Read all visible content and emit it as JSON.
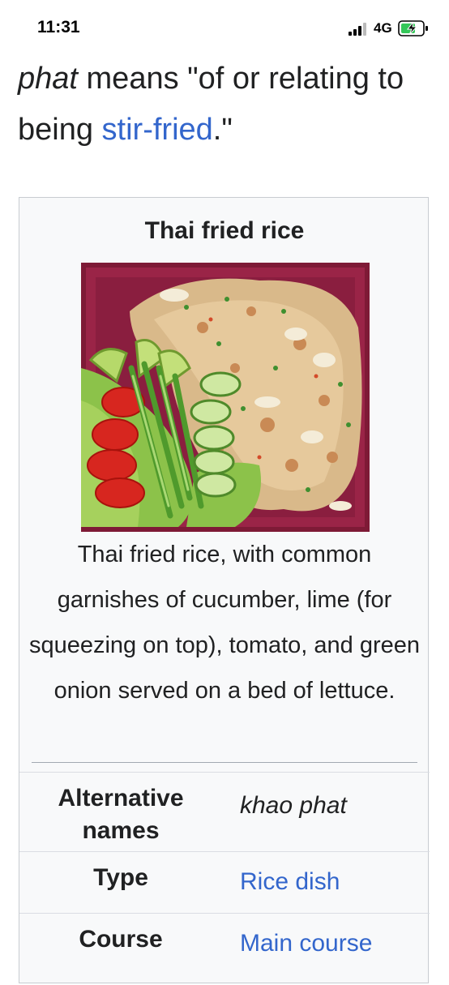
{
  "status": {
    "time": "11:31",
    "network": "4G"
  },
  "intro": {
    "italic_word": "phat",
    "text_before_link": " means \"of or relating to being ",
    "link_text": "stir-fried",
    "text_after_link": ".\""
  },
  "infobox": {
    "title": "Thai fried rice",
    "caption": "Thai fried rice, with common garnishes of cucumber, lime (for squeezing on top), tomato, and green onion served on a bed of lettuce.",
    "rows": [
      {
        "label": "Alternative names",
        "value": "khao phat"
      },
      {
        "label": "Type",
        "value": "Rice dish"
      },
      {
        "label": "Course",
        "value": "Main course"
      }
    ]
  },
  "colors": {
    "link": "#3366cc",
    "text": "#202122",
    "infobox_bg": "#f8f9fa",
    "plate": "#8e1f3f"
  }
}
